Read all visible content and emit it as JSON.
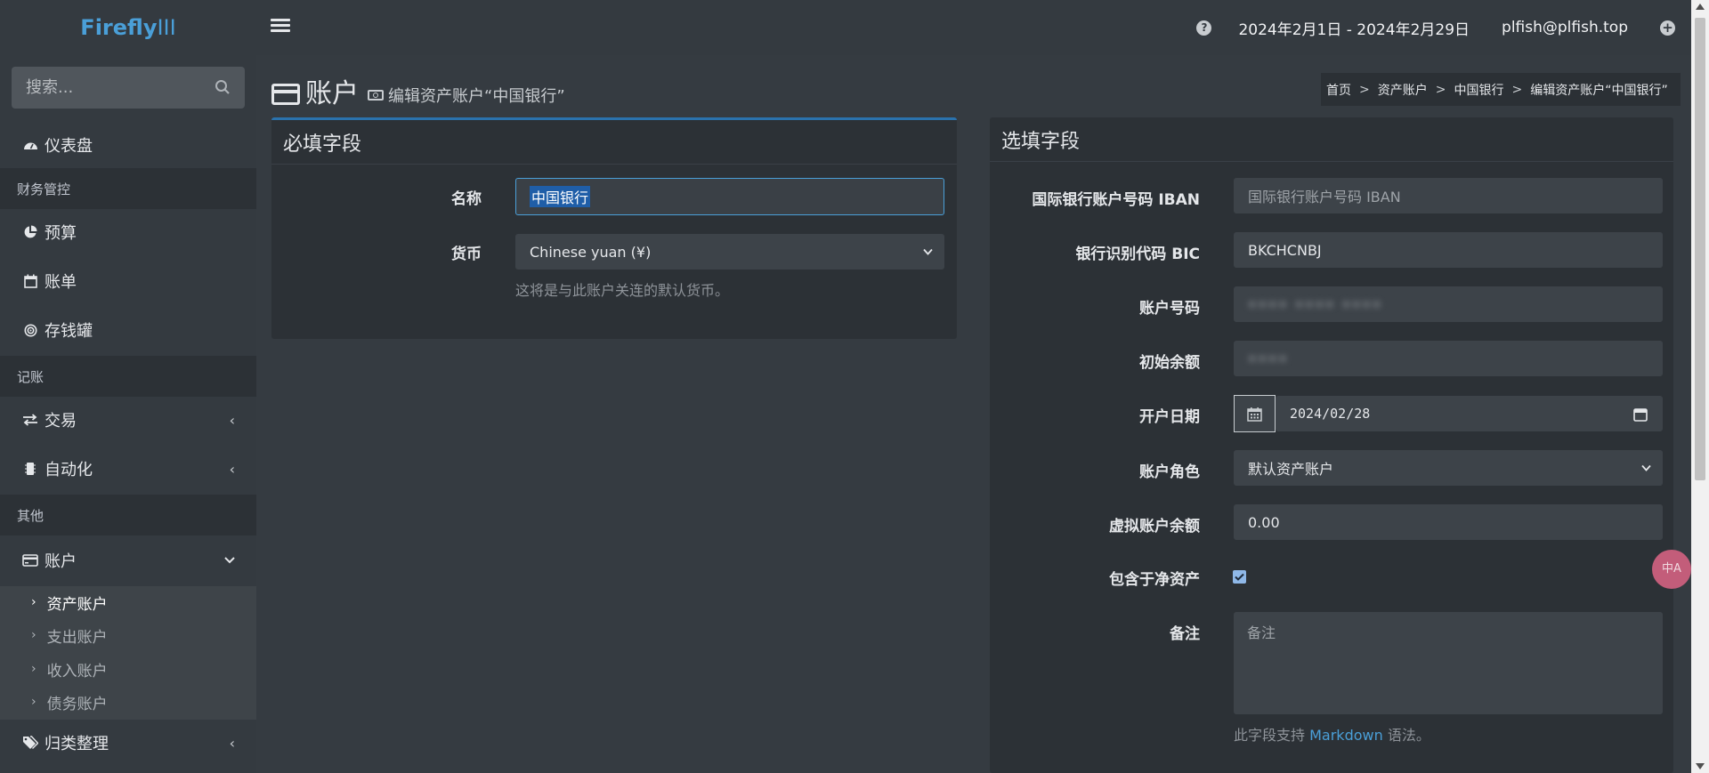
{
  "app": {
    "brand_main": "Firefly",
    "brand_suffix": "III",
    "date_range": "2024年2月1日 - 2024年2月29日",
    "user": "plfish@plfish.top"
  },
  "sidebar": {
    "search_placeholder": "搜索...",
    "dashboard": "仪表盘",
    "section_finance": "财务管控",
    "budget": "预算",
    "bills": "账单",
    "piggy_banks": "存钱罐",
    "section_bookkeeping": "记账",
    "transactions": "交易",
    "automation": "自动化",
    "section_others": "其他",
    "accounts": "账户",
    "account_sub": [
      "资产账户",
      "支出账户",
      "收入账户",
      "债务账户"
    ],
    "classification": "归类整理"
  },
  "page": {
    "title": "账户",
    "subtitle": "编辑资产账户“中国银行”",
    "breadcrumb": [
      "首页",
      "资产账户",
      "中国银行",
      "编辑资产账户“中国银行”"
    ]
  },
  "required": {
    "header": "必填字段",
    "name_label": "名称",
    "name_value": "中国银行",
    "currency_label": "货币",
    "currency_value": "Chinese yuan (¥)",
    "currency_help": "这将是与此账户关连的默认货币。"
  },
  "optional": {
    "header": "选填字段",
    "iban_label": "国际银行账户号码 IBAN",
    "iban_placeholder": "国际银行账户号码 IBAN",
    "bic_label": "银行识别代码 BIC",
    "bic_value": "BKCHCNBJ",
    "account_number_label": "账户号码",
    "account_number_value": "•••• •••• ••••",
    "opening_balance_label": "初始余额",
    "opening_balance_value": "••••",
    "opening_date_label": "开户日期",
    "opening_date_value": "2024/02/28",
    "role_label": "账户角色",
    "role_value": "默认资产账户",
    "virtual_balance_label": "虚拟账户余额",
    "virtual_balance_value": "0.00",
    "include_net_worth_label": "包含于净资产",
    "include_net_worth_checked": true,
    "notes_label": "备注",
    "notes_placeholder": "备注",
    "notes_help_prefix": "此字段支持",
    "notes_help_link": "Markdown",
    "notes_help_suffix": "语法。"
  },
  "floater_text": "中A"
}
